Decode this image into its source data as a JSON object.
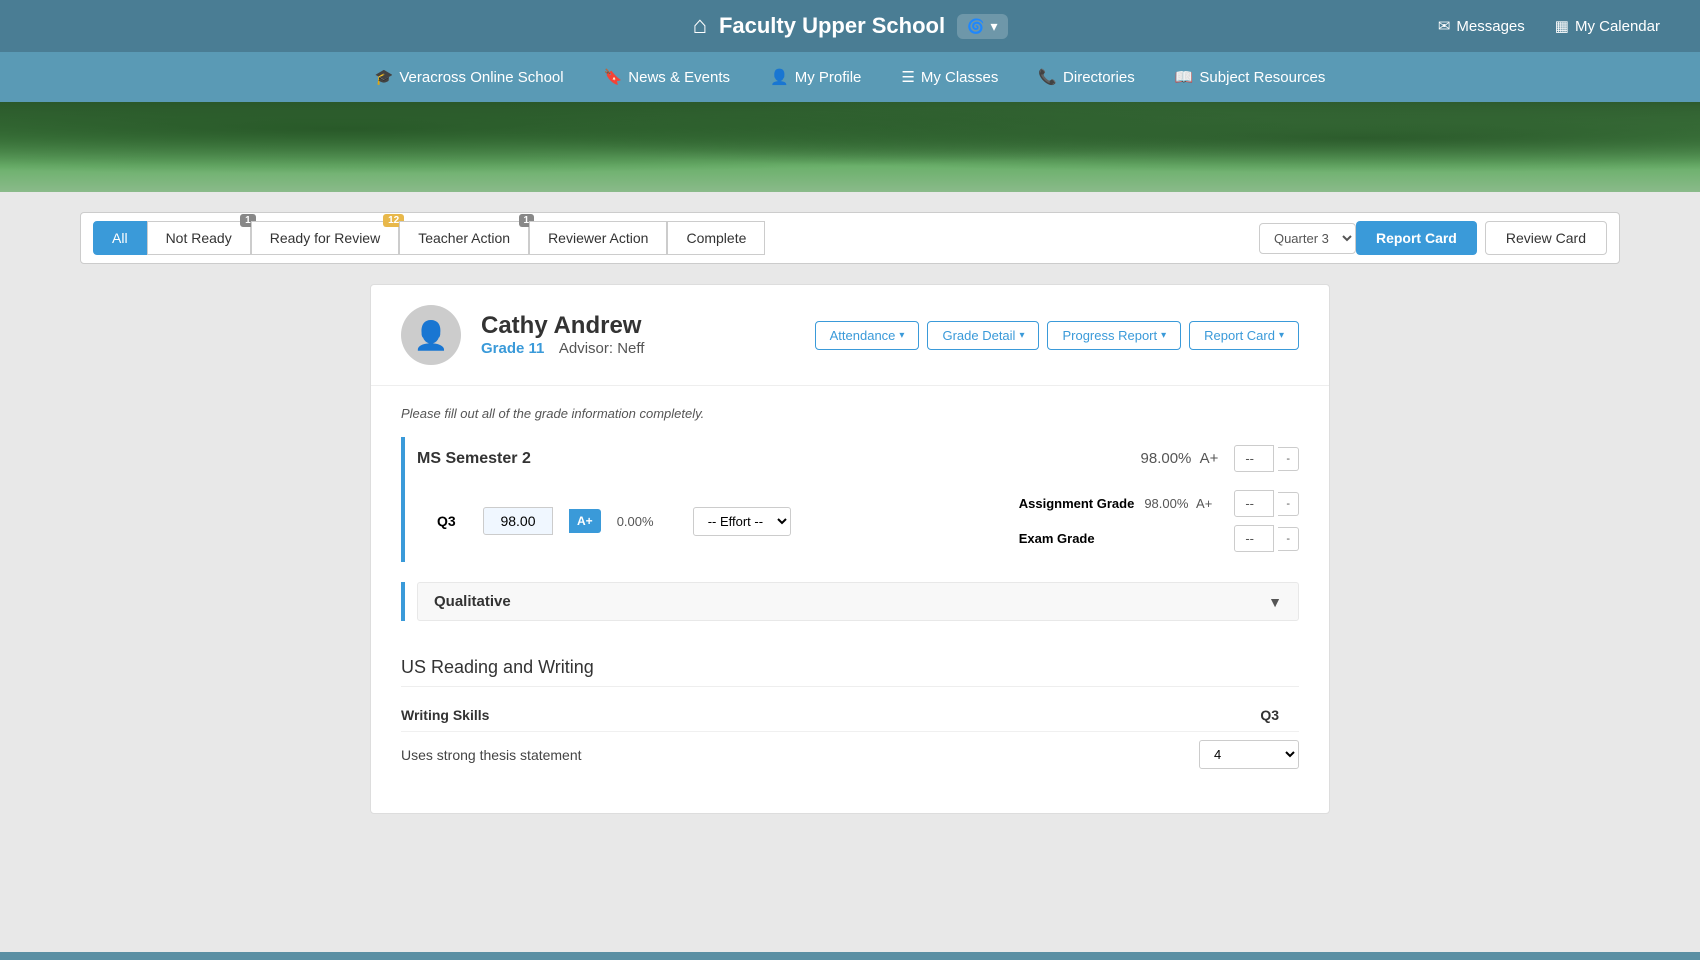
{
  "topBar": {
    "schoolName": "Faculty Upper School",
    "schoolSwitcherIcon": "spiral-icon",
    "messages": "Messages",
    "calendar": "My Calendar"
  },
  "navBar": {
    "items": [
      {
        "id": "veracross",
        "label": "Veracross Online School",
        "icon": "graduation-icon"
      },
      {
        "id": "news",
        "label": "News & Events",
        "icon": "bookmark-icon"
      },
      {
        "id": "profile",
        "label": "My Profile",
        "icon": "person-icon"
      },
      {
        "id": "classes",
        "label": "My Classes",
        "icon": "list-icon"
      },
      {
        "id": "directories",
        "label": "Directories",
        "icon": "phone-icon"
      },
      {
        "id": "resources",
        "label": "Subject Resources",
        "icon": "book-icon"
      }
    ]
  },
  "filterBar": {
    "tabs": [
      {
        "id": "all",
        "label": "All",
        "active": true,
        "badge": null
      },
      {
        "id": "notReady",
        "label": "Not Ready",
        "active": false,
        "badge": "1",
        "badgeType": "gray"
      },
      {
        "id": "readyForReview",
        "label": "Ready for Review",
        "active": false,
        "badge": "12",
        "badgeType": "yellow"
      },
      {
        "id": "teacherAction",
        "label": "Teacher Action",
        "active": false,
        "badge": "1",
        "badgeType": "gray"
      },
      {
        "id": "reviewerAction",
        "label": "Reviewer Action",
        "active": false,
        "badge": null
      },
      {
        "id": "complete",
        "label": "Complete",
        "active": false,
        "badge": null
      }
    ],
    "quarter": "Quarter 3",
    "reportCardBtn": "Report Card",
    "reviewCardBtn": "Review Card"
  },
  "student": {
    "name": "Cathy Andrew",
    "grade": "Grade 11",
    "advisor": "Advisor: Neff",
    "actions": [
      {
        "id": "attendance",
        "label": "Attendance"
      },
      {
        "id": "gradeDetail",
        "label": "Grade Detail"
      },
      {
        "id": "progressReport",
        "label": "Progress Report"
      },
      {
        "id": "reportCard",
        "label": "Report Card"
      }
    ]
  },
  "gradeCard": {
    "fillNotice": "Please fill out all of the grade information completely.",
    "semesterSection": {
      "title": "MS Semester 2",
      "overallGrade": "98.00%",
      "overallLetter": "A+",
      "gradeSelectDisplay": "--",
      "quarters": [
        {
          "label": "Q3",
          "score": "98.00",
          "letter": "A+",
          "percent": "0.00%",
          "effort": "-- Effort --",
          "assignmentGradeLabel": "Assignment Grade",
          "assignmentGradeValue": "98.00%",
          "assignmentGradeLetter": "A+",
          "assignmentSelectDisplay": "--",
          "examGradeLabel": "Exam Grade",
          "examSelectDisplay": "--"
        }
      ]
    },
    "qualitativeSection": {
      "title": "Qualitative"
    },
    "rwSection": {
      "title": "US Reading and Writing",
      "writingSkillsLabel": "Writing Skills",
      "q3Label": "Q3",
      "skills": [
        {
          "label": "Uses strong thesis statement",
          "q3Value": "4"
        }
      ]
    }
  }
}
